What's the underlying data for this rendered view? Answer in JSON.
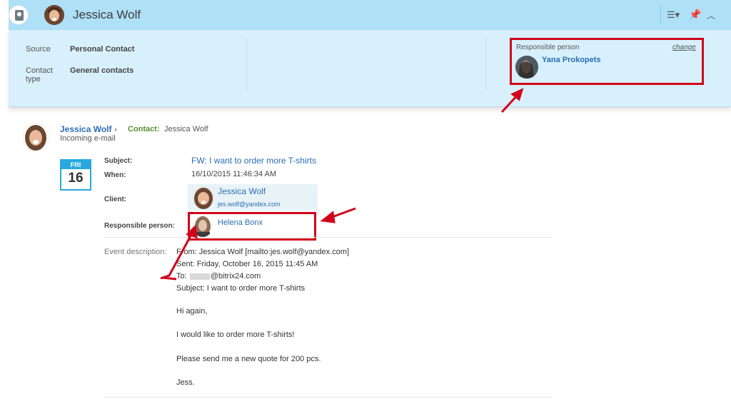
{
  "header": {
    "title": "Jessica Wolf"
  },
  "info_panel": {
    "fields": [
      {
        "label": "Source",
        "value": "Personal Contact"
      },
      {
        "label": "Contact type",
        "value": "General contacts"
      }
    ],
    "responsible": {
      "label": "Responsible person",
      "change_label": "change",
      "name": "Yana Prokopets"
    }
  },
  "event": {
    "contact_name": "Jessica Wolf",
    "chevron": "›",
    "contact_label": "Contact:",
    "contact_value": "Jessica Wolf",
    "type": "Incoming e-mail",
    "calendar": {
      "day": "FRI",
      "date": "16"
    },
    "fields": {
      "subject_label": "Subject:",
      "subject_value": "FW: I want to order more T-shirts",
      "when_label": "When:",
      "when_value": "16/10/2015 11:46:34 AM",
      "client_label": "Client:",
      "client_name": "Jessica Wolf",
      "client_email": "jes.wolf@yandex.com",
      "responsible_label": "Responsible person:",
      "responsible_name": "Helena Bonx",
      "description_label": "Event description:"
    },
    "description": {
      "from": "From: Jessica Wolf [mailto:jes.wolf@yandex.com]",
      "sent": "Sent: Friday, October 16, 2015 11:45 AM",
      "to_prefix": "To:",
      "to_suffix": "@bitrix24.com",
      "subject": "Subject: I want to order more T-shirts",
      "greeting": "Hi again,",
      "line1": "I would like to order more T-shirts!",
      "line2": "Please send me a new quote for 200 pcs.",
      "signature": "Jess."
    }
  },
  "colors": {
    "header_bg": "#aee0f7",
    "panel_bg": "#d7f0fb",
    "link": "#2a6db5",
    "highlight": "#d0021b",
    "calendar": "#29a8e0"
  },
  "icons": [
    "contact-book-icon",
    "list-settings-icon",
    "pin-icon",
    "collapse-icon"
  ]
}
